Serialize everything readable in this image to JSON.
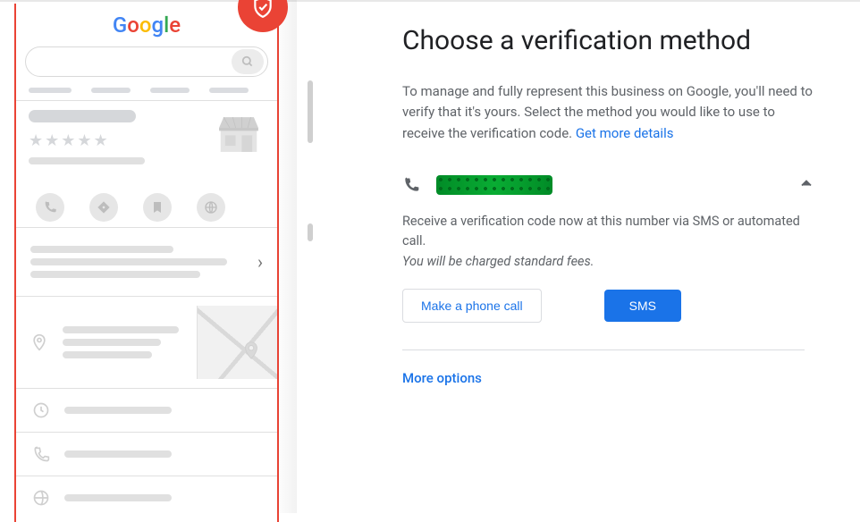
{
  "logo": {
    "letters": [
      "G",
      "o",
      "o",
      "g",
      "l",
      "e"
    ]
  },
  "heading": "Choose a verification method",
  "intro_text": "To manage and fully represent this business on Google, you'll need to verify that it's yours. Select the method you would like to use to receive the verification code. ",
  "intro_link": "Get more details",
  "method": {
    "type": "phone",
    "description": "Receive a verification code now at this number via SMS or automated call.",
    "fees_note": "You will be charged standard fees.",
    "call_button": "Make a phone call",
    "sms_button": "SMS"
  },
  "more_options": "More options"
}
